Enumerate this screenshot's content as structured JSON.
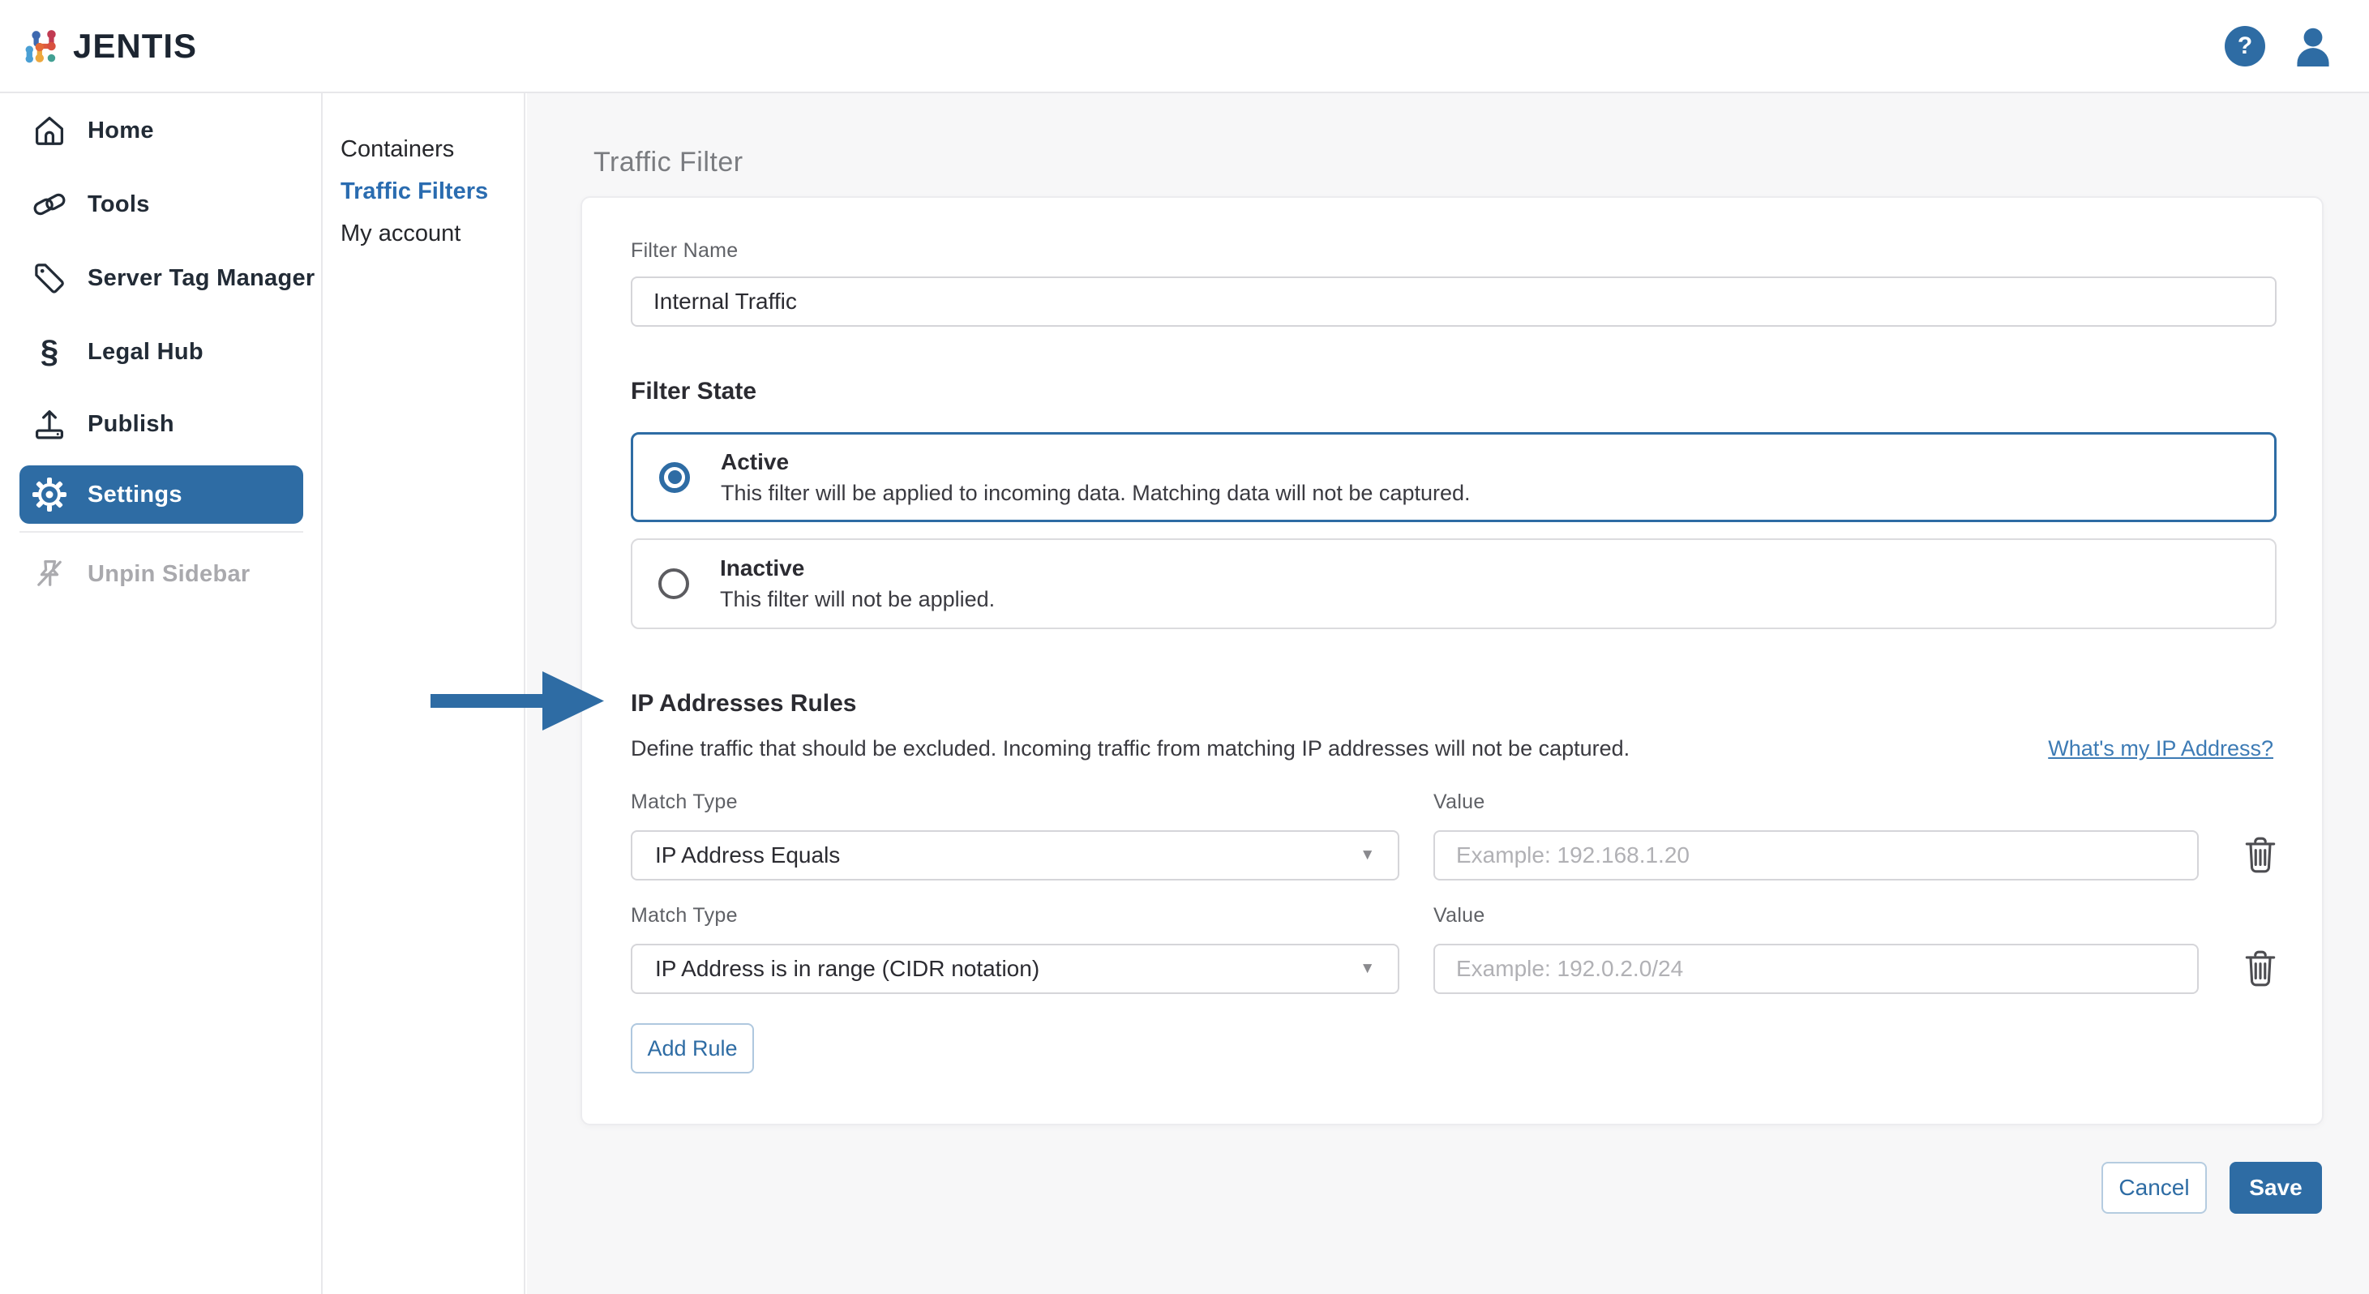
{
  "header": {
    "brand": "JENTIS",
    "help_glyph": "?"
  },
  "sidebar": {
    "items": [
      {
        "label": "Home",
        "icon": "home-icon"
      },
      {
        "label": "Tools",
        "icon": "link-icon"
      },
      {
        "label": "Server Tag Manager",
        "icon": "tag-icon"
      },
      {
        "label": "Legal Hub",
        "icon": "section-sign-icon"
      },
      {
        "label": "Publish",
        "icon": "upload-icon"
      },
      {
        "label": "Settings",
        "icon": "gear-icon",
        "active": true
      }
    ],
    "section_glyph": "§",
    "unpin_label": "Unpin Sidebar"
  },
  "subnav": {
    "items": [
      {
        "label": "Containers"
      },
      {
        "label": "Traffic Filters",
        "active": true
      },
      {
        "label": "My account"
      }
    ]
  },
  "page": {
    "title": "Traffic Filter"
  },
  "filter_name": {
    "label": "Filter Name",
    "value": "Internal Traffic"
  },
  "filter_state": {
    "heading": "Filter State",
    "options": [
      {
        "title": "Active",
        "description": "This filter will be applied to incoming data. Matching data will not be captured.",
        "selected": true
      },
      {
        "title": "Inactive",
        "description": "This filter will not be applied.",
        "selected": false
      }
    ]
  },
  "ip_rules": {
    "heading": "IP Addresses Rules",
    "description": "Define traffic that should be excluded. Incoming traffic from matching IP addresses will not be captured.",
    "help_link": "What's my IP Address?",
    "match_type_label": "Match Type",
    "value_label": "Value",
    "rules": [
      {
        "match_type": "IP Address Equals",
        "value_placeholder": "Example: 192.168.1.20"
      },
      {
        "match_type": "IP Address is in range (CIDR notation)",
        "value_placeholder": "Example: 192.0.2.0/24"
      }
    ],
    "add_rule_label": "Add Rule"
  },
  "actions": {
    "cancel": "Cancel",
    "save": "Save"
  },
  "ui": {
    "caret_glyph": "▼"
  },
  "colors": {
    "accent": "#2E6CA4",
    "link": "#3D7BB5",
    "subnav_active": "#2A6CB0",
    "page_bg": "#F7F7F8",
    "card_bg": "#FFFFFF",
    "sidebar_text": "#222B36",
    "title_gray": "#7A7C80",
    "label_gray": "#5F6166",
    "body_text": "#3A3A40",
    "placeholder": "#B1B1B5",
    "input_border": "#D5D5D9",
    "trash_icon": "#4D4D51",
    "unpin_gray": "#A9A9AD",
    "logo_navy": "#1C2531"
  }
}
